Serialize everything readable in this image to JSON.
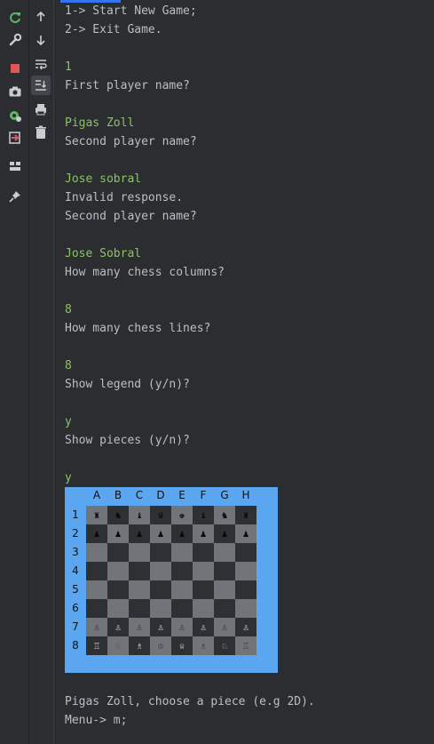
{
  "toolbar_left": [
    {
      "name": "rerun-icon",
      "label": "Rerun"
    },
    {
      "name": "wrench-icon",
      "label": "Modify Run Configuration"
    },
    {
      "name": "stop-icon",
      "label": "Stop"
    },
    {
      "name": "camera-icon",
      "label": "Dump Threads"
    },
    {
      "name": "debug-settings-icon",
      "label": "Settings"
    },
    {
      "name": "exit-icon",
      "label": "Exit"
    },
    {
      "name": "layout-icon",
      "label": "Layout"
    },
    {
      "name": "pin-icon",
      "label": "Pin Tab"
    }
  ],
  "toolbar_console": [
    {
      "name": "up-arrow-icon",
      "label": "Up the Stack Trace"
    },
    {
      "name": "down-arrow-icon",
      "label": "Down the Stack Trace"
    },
    {
      "name": "soft-wrap-icon",
      "label": "Soft-Wrap"
    },
    {
      "name": "scroll-to-end-icon",
      "label": "Scroll to the End"
    },
    {
      "name": "print-icon",
      "label": "Print"
    },
    {
      "name": "trash-icon",
      "label": "Clear All"
    }
  ],
  "console": {
    "lines": [
      {
        "text": "1-> Start New Game;",
        "type": "output"
      },
      {
        "text": "2-> Exit Game.",
        "type": "output"
      },
      {
        "text": "1",
        "type": "input"
      },
      {
        "text": "First player name?",
        "type": "output"
      },
      {
        "text": "Pigas Zoll",
        "type": "input"
      },
      {
        "text": "Second player name?",
        "type": "output"
      },
      {
        "text": "Jose sobral",
        "type": "input"
      },
      {
        "text": "Invalid response.",
        "type": "output"
      },
      {
        "text": "Second player name?",
        "type": "output"
      },
      {
        "text": "Jose Sobral",
        "type": "input"
      },
      {
        "text": "How many chess columns?",
        "type": "output"
      },
      {
        "text": "8",
        "type": "input"
      },
      {
        "text": "How many chess lines?",
        "type": "output"
      },
      {
        "text": "8",
        "type": "input"
      },
      {
        "text": "Show legend (y/n)?",
        "type": "output"
      },
      {
        "text": "y",
        "type": "input"
      },
      {
        "text": "Show pieces (y/n)?",
        "type": "output"
      },
      {
        "text": "y",
        "type": "input"
      },
      {
        "text": "Pigas Zoll, choose a piece (e.g 2D).",
        "type": "output"
      },
      {
        "text": "Menu-> m;",
        "type": "output"
      }
    ]
  },
  "board": {
    "columns": [
      "A",
      "B",
      "C",
      "D",
      "E",
      "F",
      "G",
      "H"
    ],
    "rows": [
      "1",
      "2",
      "3",
      "4",
      "5",
      "6",
      "7",
      "8"
    ],
    "pieces": [
      [
        "♜",
        "♞",
        "♝",
        "♛",
        "♚",
        "♝",
        "♞",
        "♜"
      ],
      [
        "♟",
        "♟",
        "♟",
        "♟",
        "♟",
        "♟",
        "♟",
        "♟"
      ],
      [
        "",
        "",
        "",
        "",
        "",
        "",
        "",
        ""
      ],
      [
        "",
        "",
        "",
        "",
        "",
        "",
        "",
        ""
      ],
      [
        "",
        "",
        "",
        "",
        "",
        "",
        "",
        ""
      ],
      [
        "",
        "",
        "",
        "",
        "",
        "",
        "",
        ""
      ],
      [
        "♙",
        "♙",
        "♙",
        "♙",
        "♙",
        "♙",
        "♙",
        "♙"
      ],
      [
        "♖",
        "♘",
        "♗",
        "♔",
        "♕",
        "♗",
        "♘",
        "♖"
      ]
    ]
  },
  "colors": {
    "background": "#2b2d30",
    "text": "#bcbec4",
    "input_text": "#8fc06c",
    "board_frame": "#5aa6f0",
    "square_light": "#717479",
    "square_dark": "#2e3034"
  }
}
